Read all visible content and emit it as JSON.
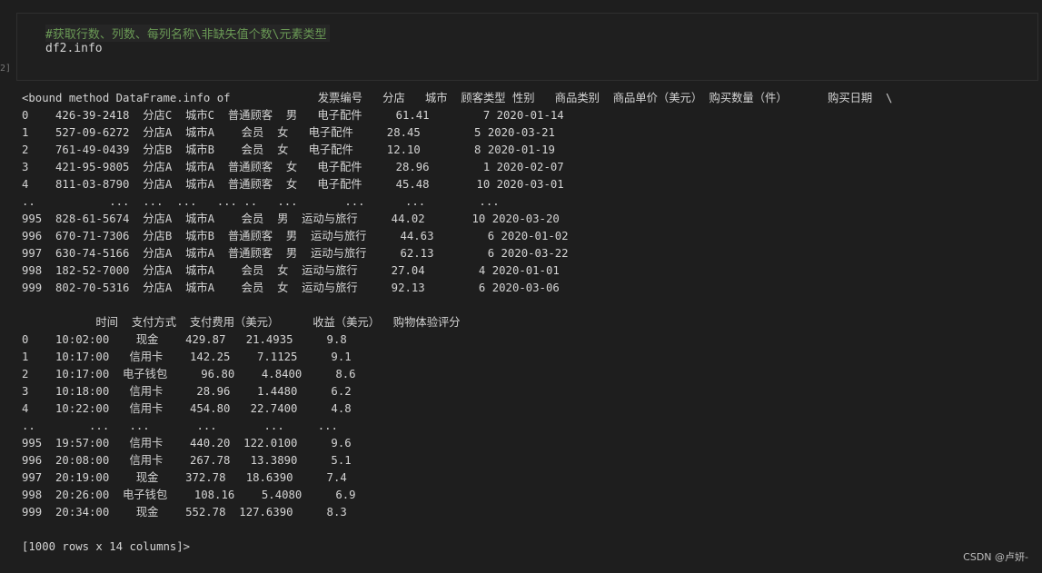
{
  "cell": {
    "exec_count": "2]",
    "comment": "#获取行数、列数、每列名称\\非缺失值个数\\元素类型",
    "code": "df2.info"
  },
  "output": {
    "lines": [
      "<bound method DataFrame.info of             发票编号   分店   城市  顾客类型 性别   商品类别  商品单价（美元） 购买数量（件）      购买日期  \\",
      "0    426-39-2418  分店C  城市C  普通顾客  男   电子配件     61.41        7 2020-01-14",
      "1    527-09-6272  分店A  城市A    会员  女   电子配件     28.45        5 2020-03-21",
      "2    761-49-0439  分店B  城市B    会员  女   电子配件     12.10        8 2020-01-19",
      "3    421-95-9805  分店A  城市A  普通顾客  女   电子配件     28.96        1 2020-02-07",
      "4    811-03-8790  分店A  城市A  普通顾客  女   电子配件     45.48       10 2020-03-01",
      "..           ...  ...  ...   ... ..   ...       ...      ...        ...",
      "995  828-61-5674  分店A  城市A    会员  男  运动与旅行     44.02       10 2020-03-20",
      "996  670-71-7306  分店B  城市B  普通顾客  男  运动与旅行     44.63        6 2020-01-02",
      "997  630-74-5166  分店A  城市A  普通顾客  男  运动与旅行     62.13        6 2020-03-22",
      "998  182-52-7000  分店A  城市A    会员  女  运动与旅行     27.04        4 2020-01-01",
      "999  802-70-5316  分店A  城市A    会员  女  运动与旅行     92.13        6 2020-03-06",
      "",
      "           时间  支付方式  支付费用（美元）     收益（美元）  购物体验评分",
      "0    10:02:00    现金    429.87   21.4935     9.8",
      "1    10:17:00   信用卡    142.25    7.1125     9.1",
      "2    10:17:00  电子钱包     96.80    4.8400     8.6",
      "3    10:18:00   信用卡     28.96    1.4480     6.2",
      "4    10:22:00   信用卡    454.80   22.7400     4.8",
      "..        ...   ...       ...       ...     ...",
      "995  19:57:00   信用卡    440.20  122.0100     9.6",
      "996  20:08:00   信用卡    267.78   13.3890     5.1",
      "997  20:19:00    现金    372.78   18.6390     7.4",
      "998  20:26:00  电子钱包    108.16    5.4080     6.9",
      "999  20:34:00    现金    552.78  127.6390     8.3",
      "",
      "[1000 rows x 14 columns]>"
    ]
  },
  "watermark": "CSDN @卢妍-"
}
